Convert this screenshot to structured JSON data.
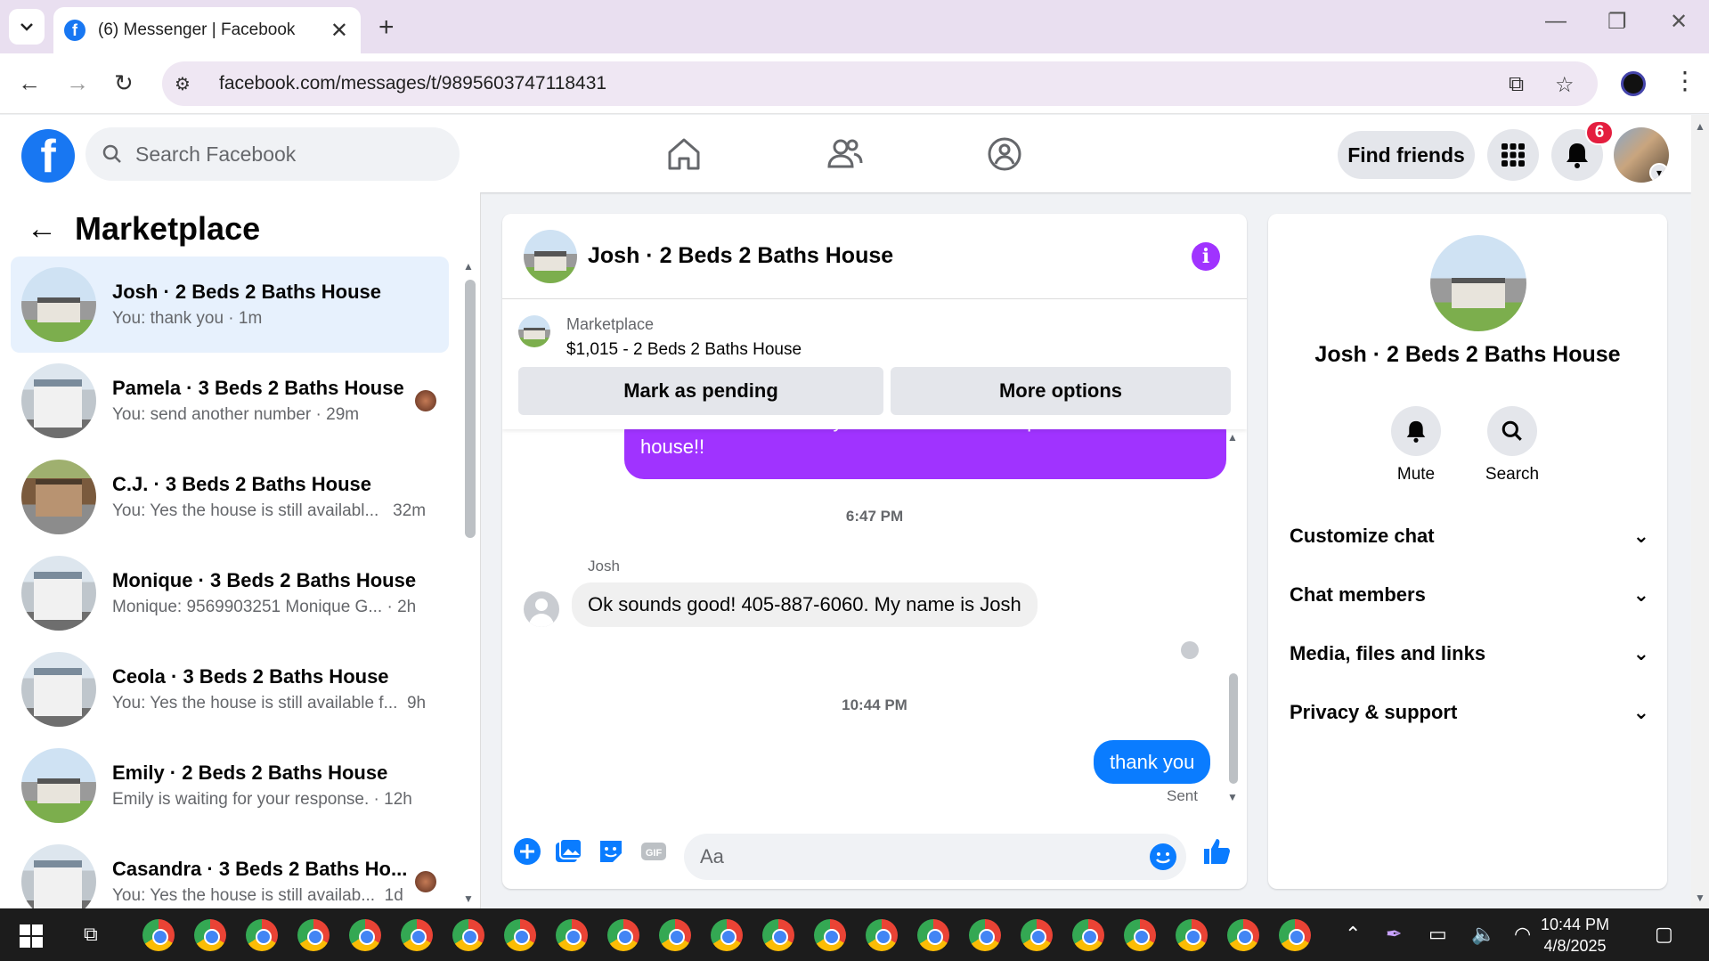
{
  "browser": {
    "tab_title": "(6) Messenger | Facebook",
    "url": "facebook.com/messages/t/9895603747118431"
  },
  "fb": {
    "search_placeholder": "Search Facebook",
    "find_friends": "Find friends",
    "notification_count": "6"
  },
  "left": {
    "title": "Marketplace",
    "conversations": [
      {
        "name": "Josh · 2 Beds 2 Baths House",
        "preview": "You: thank you · 1m",
        "active": true
      },
      {
        "name": "Pamela · 3 Beds 2 Baths House",
        "preview": "You: send another number · 29m"
      },
      {
        "name": "C.J. · 3 Beds 2 Baths House",
        "preview": "You: Yes the house is still availabl...",
        "time": "32m"
      },
      {
        "name": "Monique · 3 Beds 2 Baths House",
        "preview": "Monique: 9569903251 Monique G...",
        "time": "2h"
      },
      {
        "name": "Ceola · 3 Beds 2 Baths House",
        "preview": "You: Yes the house is still available f...",
        "time": "9h"
      },
      {
        "name": "Emily · 2 Beds 2 Baths House",
        "preview": "Emily is waiting for your response. · 12h"
      },
      {
        "name": "Casandra · 3 Beds 2 Baths Ho...",
        "preview": "You: Yes the house is still availab...",
        "time": "1d"
      }
    ]
  },
  "chat": {
    "title": "Josh · 2 Beds 2 Baths House",
    "marketplace_label": "Marketplace",
    "listing": "$1,015 - 2 Beds 2 Baths House",
    "mark_pending": "Mark as pending",
    "more_options": "More options",
    "msg_out_1": "number so i can send you details and the requirements about the house!!",
    "time_1": "6:47 PM",
    "sender": "Josh",
    "msg_in_1": "Ok sounds good! 405-887-6060. My name is Josh",
    "time_2": "10:44 PM",
    "msg_out_2": "thank you",
    "sent": "Sent",
    "input_placeholder": "Aa"
  },
  "right": {
    "name": "Josh · 2 Beds 2 Baths House",
    "mute": "Mute",
    "search": "Search",
    "rows": [
      "Customize chat",
      "Chat members",
      "Media, files and links",
      "Privacy & support"
    ]
  },
  "taskbar": {
    "time": "10:44 PM",
    "date": "4/8/2025"
  }
}
